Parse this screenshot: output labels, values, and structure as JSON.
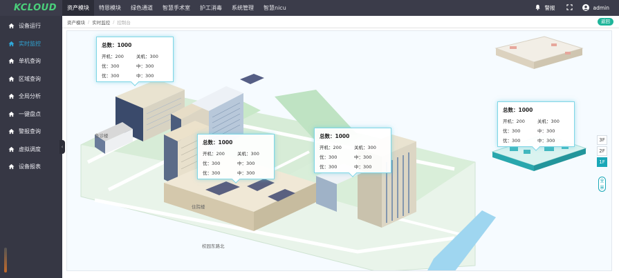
{
  "app": {
    "logo": "KCLOUD"
  },
  "topnav": {
    "items": [
      "资产模块",
      "特恩模块",
      "绿色通道",
      "智慧手术室",
      "护工消毒",
      "系统管理",
      "智慧nicu"
    ],
    "active_index": 0
  },
  "topright": {
    "alarm_label": "警报",
    "user_name": "admin"
  },
  "sidebar": {
    "items": [
      "设备运行",
      "实时监控",
      "单机查询",
      "区域查询",
      "全局分析",
      "一键盘点",
      "警报查询",
      "虚拟调度",
      "设备报表"
    ],
    "active_index": 1
  },
  "breadcrumb": {
    "items": [
      "资产模块",
      "实时监控",
      "控制台"
    ]
  },
  "back_button": "返回",
  "popups": [
    {
      "total": "总数：1000",
      "cells": [
        "开机：200",
        "关机：300",
        "优：300",
        "中：300",
        "优：300",
        "中：300"
      ]
    },
    {
      "total": "总数：1000",
      "cells": [
        "开机：200",
        "关机：300",
        "优：300",
        "中：300",
        "优：300",
        "中：300"
      ]
    },
    {
      "total": "总数：1000",
      "cells": [
        "开机：200",
        "关机：300",
        "优：300",
        "中：300",
        "优：300",
        "中：300"
      ]
    },
    {
      "total": "总数：1000",
      "cells": [
        "开机：200",
        "关机：300",
        "优：300",
        "中：300",
        "优：300",
        "中：300"
      ]
    }
  ],
  "floors": {
    "buttons": [
      "3F",
      "2F",
      "1F"
    ],
    "active": "1F",
    "all_label": "全景"
  },
  "map_labels": {
    "building_a": "急诊楼",
    "building_b": "住院楼",
    "road": "校园东路北"
  },
  "colors": {
    "topbar": "#3b3c4a",
    "sidebar": "#363744",
    "accent": "#1aa7b7",
    "active_link": "#2fa7d8",
    "back_btn": "#1fb59a"
  }
}
